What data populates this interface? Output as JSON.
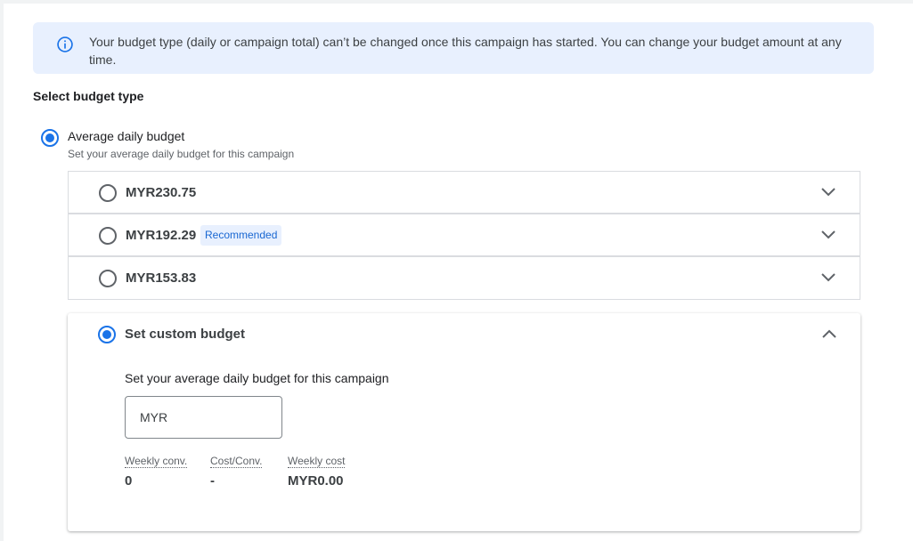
{
  "info_banner": {
    "icon": "info-icon",
    "text": "Your budget type (daily or campaign total) can’t be changed once this campaign has started. You can change your budget amount at any time."
  },
  "section_heading": "Select budget type",
  "budget_type": {
    "label": "Average daily budget",
    "sublabel": "Set your average daily budget for this campaign",
    "selected": true
  },
  "options": [
    {
      "amount": "MYR230.75",
      "badge": "",
      "selected": false
    },
    {
      "amount": "MYR192.29",
      "badge": "Recommended",
      "selected": false
    },
    {
      "amount": "MYR153.83",
      "badge": "",
      "selected": false
    }
  ],
  "custom": {
    "title": "Set custom budget",
    "selected": true,
    "description": "Set your average daily budget for this campaign",
    "input_placeholder": "MYR",
    "input_value": "",
    "metrics": [
      {
        "label": "Weekly conv.",
        "value": "0"
      },
      {
        "label": "Cost/Conv.",
        "value": "-"
      },
      {
        "label": "Weekly cost",
        "value": "MYR0.00"
      }
    ]
  },
  "colors": {
    "accent": "#1a73e8",
    "banner_bg": "#e8f0fe",
    "badge_text": "#1967d2"
  }
}
